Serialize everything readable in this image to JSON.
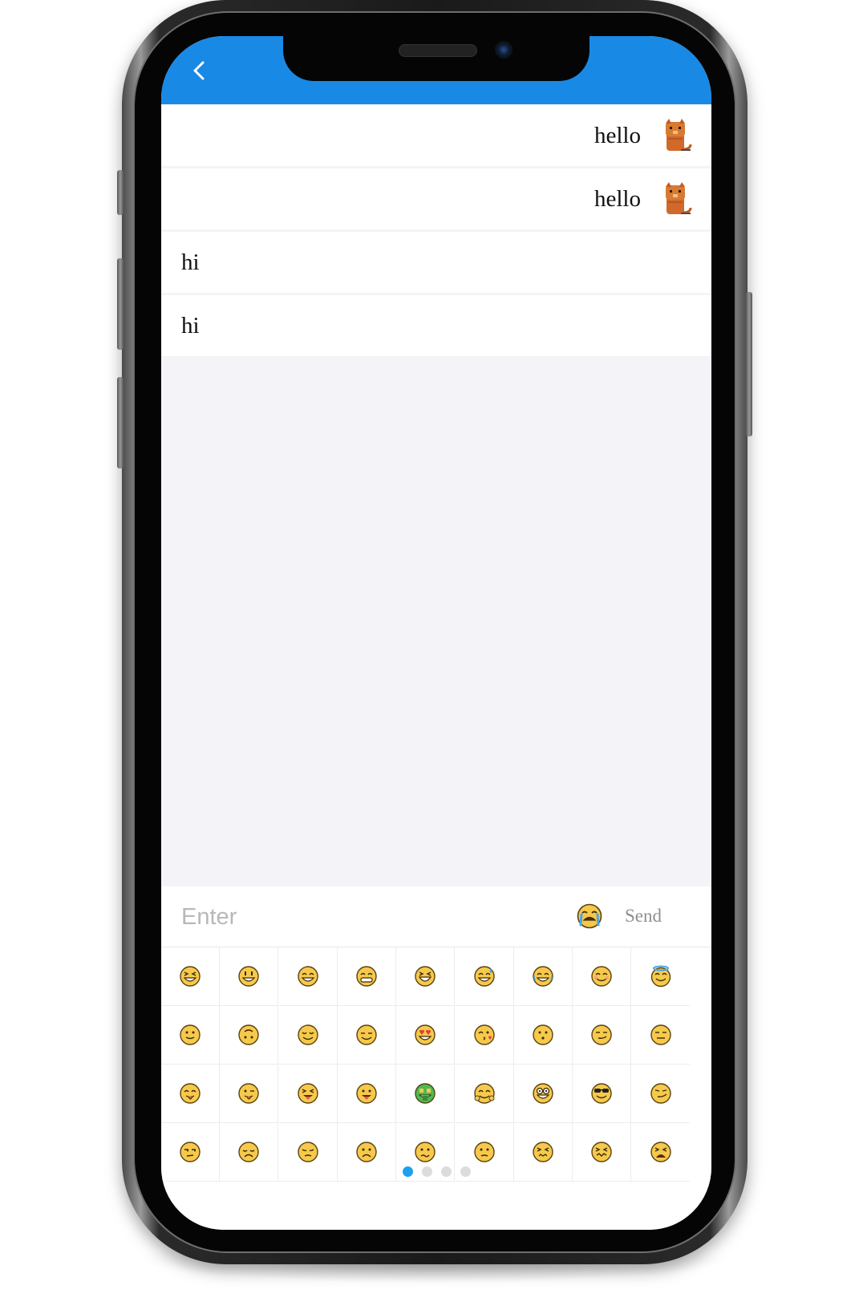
{
  "header": {
    "title": "",
    "back_icon": "chevron-left-icon",
    "accent_color": "#1989e6"
  },
  "messages": [
    {
      "side": "right",
      "text": "hello",
      "avatar": "cat-avatar"
    },
    {
      "side": "right",
      "text": "hello",
      "avatar": "cat-avatar"
    },
    {
      "side": "left",
      "text": "hi"
    },
    {
      "side": "left",
      "text": "hi"
    }
  ],
  "input": {
    "placeholder": "Enter",
    "value": "",
    "emoji_toggle_icon": "crying-face-icon",
    "send_label": "Send"
  },
  "emoji_panel": {
    "rows": [
      [
        "grinning-squint",
        "grinning",
        "grinning-smile",
        "beaming",
        "grinning-squint-2",
        "sweat-smile",
        "tears-of-joy",
        "smiling",
        "halo"
      ],
      [
        "slight-smile",
        "upside-down",
        "relieved",
        "expressionless-sleepy",
        "heart-eyes",
        "kissing-face",
        "neutral-face",
        "smirk-face",
        "unamused"
      ],
      [
        "savoring-food",
        "tongue-wink",
        "tongue-squint",
        "tongue-out",
        "money-mouth",
        "hugging",
        "nerd",
        "sunglasses",
        "smirking"
      ],
      [
        "unamused-side",
        "disappointed",
        "pensive",
        "worried",
        "confused",
        "slight-frown",
        "persevering",
        "confounded",
        "weary"
      ]
    ],
    "page_count": 4,
    "active_page": 1,
    "active_dot_color": "#1ea0f0"
  }
}
